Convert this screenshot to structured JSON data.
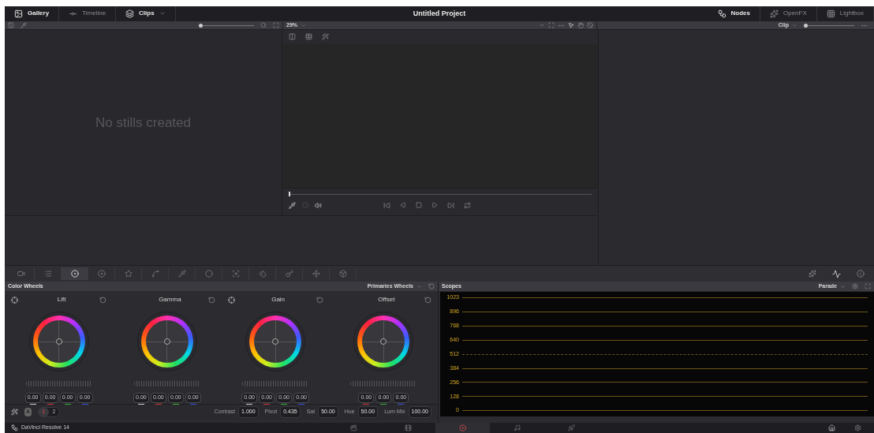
{
  "top_bar": {
    "left_tabs": [
      {
        "kind": "gallery",
        "label": "Gallery",
        "selected": true
      },
      {
        "kind": "timeline",
        "label": "Timeline",
        "selected": false
      },
      {
        "kind": "clips",
        "label": "Clips",
        "selected": true
      }
    ],
    "title": "Untitled Project",
    "right_tabs": [
      {
        "kind": "nodes",
        "label": "Nodes",
        "selected": true
      },
      {
        "kind": "openfx",
        "label": "OpenFX",
        "selected": false
      },
      {
        "kind": "lightbox",
        "label": "Lightbox",
        "selected": false
      }
    ]
  },
  "gallery": {
    "empty_message": "No stills created",
    "zoom_slider": {
      "level": 0.0
    }
  },
  "viewer": {
    "zoom": "29%"
  },
  "node_editor": {
    "mode": "Clip",
    "zoom_slider": {
      "level": 0.0
    }
  },
  "palette": [
    {
      "kind": "camera",
      "selected": false
    },
    {
      "kind": "list",
      "selected": false
    },
    {
      "kind": "wheels",
      "selected": true
    },
    {
      "kind": "rgb",
      "selected": false
    },
    {
      "kind": "star",
      "selected": false
    },
    {
      "kind": "curves",
      "selected": false
    },
    {
      "kind": "qualifier",
      "selected": false
    },
    {
      "kind": "window",
      "selected": false
    },
    {
      "kind": "tracker",
      "selected": false
    },
    {
      "kind": "blur",
      "selected": false
    },
    {
      "kind": "key",
      "selected": false
    },
    {
      "kind": "sizing",
      "selected": false
    },
    {
      "kind": "stereo",
      "selected": false
    }
  ],
  "color_wheels": {
    "title": "Color Wheels",
    "mode": "Primaries Wheels",
    "wheels": [
      {
        "name": "Lift",
        "values": [
          "0.00",
          "0.00",
          "0.00",
          "0.00"
        ]
      },
      {
        "name": "Gamma",
        "values": [
          "0.00",
          "0.00",
          "0.00",
          "0.00"
        ]
      },
      {
        "name": "Gain",
        "values": [
          "0.00",
          "0.00",
          "0.00",
          "0.00"
        ]
      },
      {
        "name": "Offset",
        "values": [
          "0.00",
          "0.00",
          "0.00"
        ]
      }
    ],
    "auto_badge": "A",
    "pages": [
      {
        "label": "1",
        "selected": true
      },
      {
        "label": "2",
        "selected": false
      }
    ],
    "params": [
      {
        "label": "Contrast",
        "value": "1.000"
      },
      {
        "label": "Pivot",
        "value": "0.435"
      },
      {
        "label": "Sat",
        "value": "50.00"
      },
      {
        "label": "Hue",
        "value": "50.00"
      },
      {
        "label": "Lum Mix",
        "value": "100.00"
      }
    ]
  },
  "scopes": {
    "title": "Scopes",
    "mode": "Parade",
    "scale": [
      "1023",
      "896",
      "768",
      "640",
      "512",
      "384",
      "256",
      "128",
      "0"
    ]
  },
  "status_bar": {
    "app_name": "DaVinci Resolve 14",
    "pages": [
      {
        "kind": "media",
        "selected": false
      },
      {
        "kind": "edit",
        "selected": false
      },
      {
        "kind": "color",
        "selected": true
      },
      {
        "kind": "fairlight",
        "selected": false
      },
      {
        "kind": "deliver",
        "selected": false
      }
    ]
  }
}
